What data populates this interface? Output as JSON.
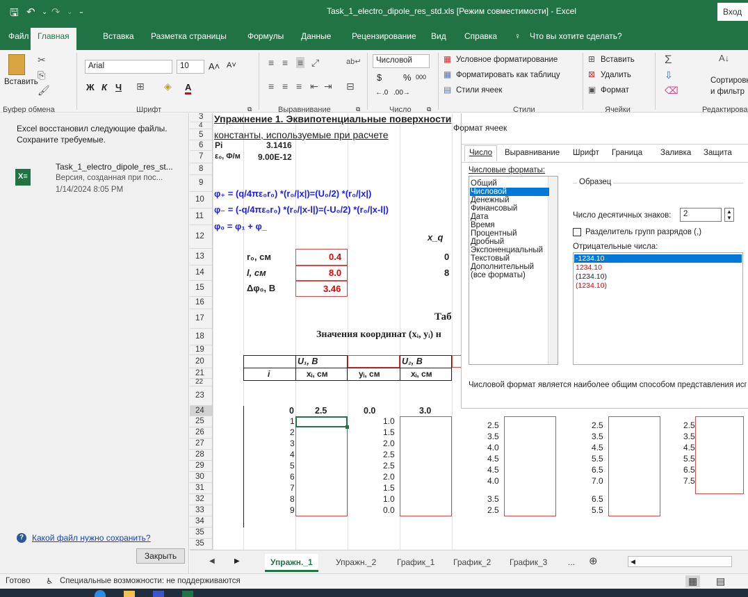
{
  "window": {
    "title": "Task_1_electro_dipole_res_std.xls [Режим совместимости] - Excel",
    "sign_in": "Вход"
  },
  "tabs": [
    "Файл",
    "Главная",
    "Вставка",
    "Разметка страницы",
    "Формулы",
    "Данные",
    "Рецензирование",
    "Вид",
    "Справка"
  ],
  "tell_me": "Что вы хотите сделать?",
  "ribbon": {
    "paste": "Вставить",
    "font_name": "Arial",
    "font_size": "10",
    "bold": "Ж",
    "italic": "К",
    "underline": "Ч",
    "number_format": "Числовой",
    "percent": "%",
    "thousands": "000",
    "cond_format": "Условное форматирование",
    "format_table": "Форматировать как таблицу",
    "cell_styles": "Стили ячеек",
    "insert": "Вставить",
    "delete": "Удалить",
    "format": "Формат",
    "sort": "Сортировка",
    "filter": "и фильтр",
    "groups": {
      "clipboard": "Буфер обмена",
      "font": "Шрифт",
      "alignment": "Выравнивание",
      "number": "Число",
      "styles": "Стили",
      "cells": "Ячейки",
      "editing": "Редактирован"
    }
  },
  "recovery": {
    "message": "Excel восстановил следующие файлы. Сохраните требуемые.",
    "file_name": "Task_1_electro_dipole_res_st...",
    "file_version": "Версия, созданная при пос...",
    "file_date": "1/14/2024 8:05 PM",
    "help_link": "Какой файл нужно сохранить?",
    "close": "Закрыть"
  },
  "rows": [
    "3",
    "4",
    "5",
    "6",
    "7",
    "8",
    "9",
    "10",
    "11",
    "12",
    "13",
    "14",
    "15",
    "16",
    "17",
    "18",
    "19",
    "20",
    "21",
    "22",
    "23",
    "24",
    "25",
    "26",
    "27",
    "28",
    "29",
    "30",
    "31",
    "32",
    "33",
    "34",
    "35"
  ],
  "sheet": {
    "title": "Упражнение 1. Эквипотенциальные поверхности",
    "consts_header": "константы, используемые при расчете",
    "pi_label": "Pi",
    "pi_value": "3.1416",
    "eps_label": "ε₀, Ф/м",
    "eps_value": "9.00E-12",
    "formula1": "φ₊ = (q/4πε₀r₀) *(r₀/|x|)=(U₀/2) *(r₀/|x|)",
    "formula2": "φ₋ = (-q/4πε₀r₀) *(r₀/|x-l|)=(-U₀/2) *(r₀/|x-l|)",
    "formula3": "φ₀ = φ₁ + φ_",
    "xq_label": "x_q",
    "r0_label": "r₀, см",
    "r0_value": "0.4",
    "l_label": "l, см",
    "l_value": "8.0",
    "dphi_label": "Δφ₀, В",
    "dphi_value": "3.46",
    "xq_val1": "0",
    "xq_val2": "8",
    "table_title": "Таб",
    "table_subtitle": "Значения координат (xᵢ, yᵢ) н",
    "u1": "U₁, B",
    "u2": "U₂, B",
    "h_i": "i",
    "h_x1": "xᵢ, см",
    "h_y1": "yᵢ, см",
    "h_x2": "xᵢ, см",
    "i_values": [
      "0",
      "1",
      "2",
      "3",
      "4",
      "5",
      "6",
      "7",
      "8",
      "9"
    ],
    "x_row23": "2.5",
    "y_values": [
      "0.0",
      "1.0",
      "1.5",
      "2.0",
      "2.5",
      "2.5",
      "2.0",
      "1.5",
      "1.0",
      "0.0"
    ],
    "x2_row23": "3.0",
    "colF": [
      "2.5",
      "3.5",
      "4.0",
      "4.5",
      "4.5",
      "4.0",
      "3.5",
      "2.5"
    ],
    "colH": [
      "2.5",
      "3.5",
      "4.5",
      "5.5",
      "6.5",
      "7.0",
      "6.5",
      "5.5"
    ],
    "colJ": [
      "2.5",
      "3.5",
      "4.5",
      "5.5",
      "6.5",
      "7.5"
    ]
  },
  "dialog": {
    "title": "Формат ячеек",
    "tabs": [
      "Число",
      "Выравнивание",
      "Шрифт",
      "Граница",
      "Заливка",
      "Защита"
    ],
    "formats_label": "Числовые форматы:",
    "formats": [
      "Общий",
      "Числовой",
      "Денежный",
      "Финансовый",
      "Дата",
      "Время",
      "Процентный",
      "Дробный",
      "Экспоненциальный",
      "Текстовый",
      "Дополнительный",
      "(все форматы)"
    ],
    "sample_label": "Образец",
    "decimals_label": "Число десятичных знаков:",
    "decimals_value": "2",
    "separator_label": "Разделитель групп разрядов (,)",
    "negative_label": "Отрицательные числа:",
    "negatives": [
      "-1234.10",
      "1234.10",
      "(1234.10)",
      "(1234.10)"
    ],
    "description": "Числовой формат является наиболее общим способом представления используются также форматы ''Денежный'' и ''Финансовый''."
  },
  "sheet_tabs": [
    "Упражн._1",
    "Упражн._2",
    "График_1",
    "График_2",
    "График_3",
    "..."
  ],
  "status": {
    "ready": "Готово",
    "accessibility": "Специальные возможности: не поддерживаются"
  },
  "colors": {
    "excel_green": "#217346",
    "formula_blue": "#1a1aff",
    "value_red": "#e00000",
    "select_blue": "#0078d7"
  }
}
